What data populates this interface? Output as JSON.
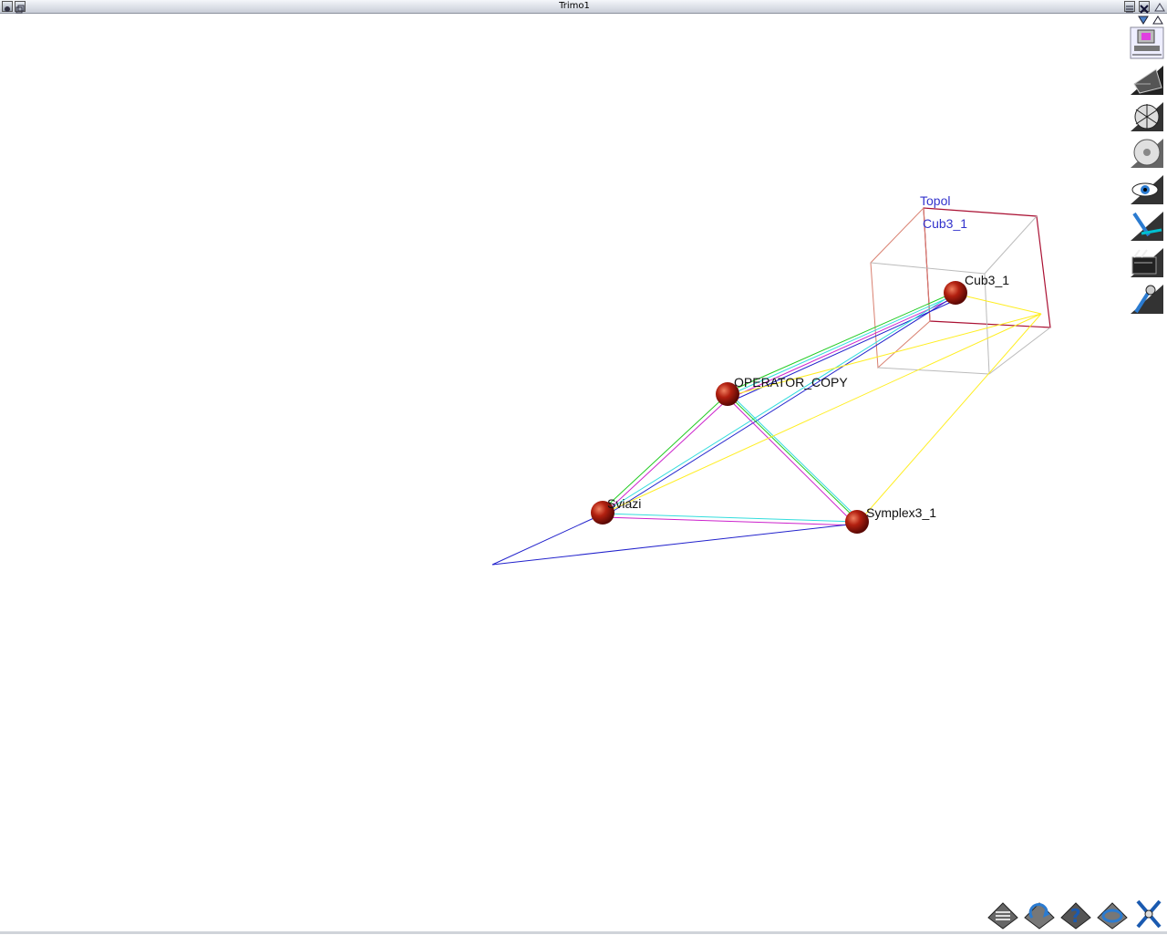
{
  "window": {
    "title": "Trimo1"
  },
  "scene": {
    "nodes": [
      {
        "id": "cub3",
        "label": "Cub3_1"
      },
      {
        "id": "operator",
        "label": "OPERATOR_COPY"
      },
      {
        "id": "sviazi",
        "label": "Sviazi"
      },
      {
        "id": "symplex",
        "label": "Symplex3_1"
      }
    ],
    "box_labels": {
      "topol": "Topol",
      "cub": "Cub3_1"
    },
    "colors": {
      "node": "#a01808",
      "green": "#22cc22",
      "cyan": "#33dddd",
      "magenta": "#cc22cc",
      "blue": "#2222cc",
      "yellow": "#ffee22",
      "cube_front": "#aa1133",
      "cube_back": "#bbbbbb"
    }
  },
  "toolbars": {
    "title_buttons_right": [
      "menu-icon",
      "close-icon",
      "arrow-down-icon",
      "arrow-up-icon"
    ],
    "right": [
      "monitor-icon",
      "envelope-icon",
      "web-icon",
      "disc-icon",
      "eye-icon",
      "pen-icon",
      "clapper-icon",
      "microphone-icon"
    ],
    "bottom": [
      "layers-icon",
      "rotate-icon",
      "help-icon",
      "refresh-icon",
      "exit-icon"
    ]
  }
}
